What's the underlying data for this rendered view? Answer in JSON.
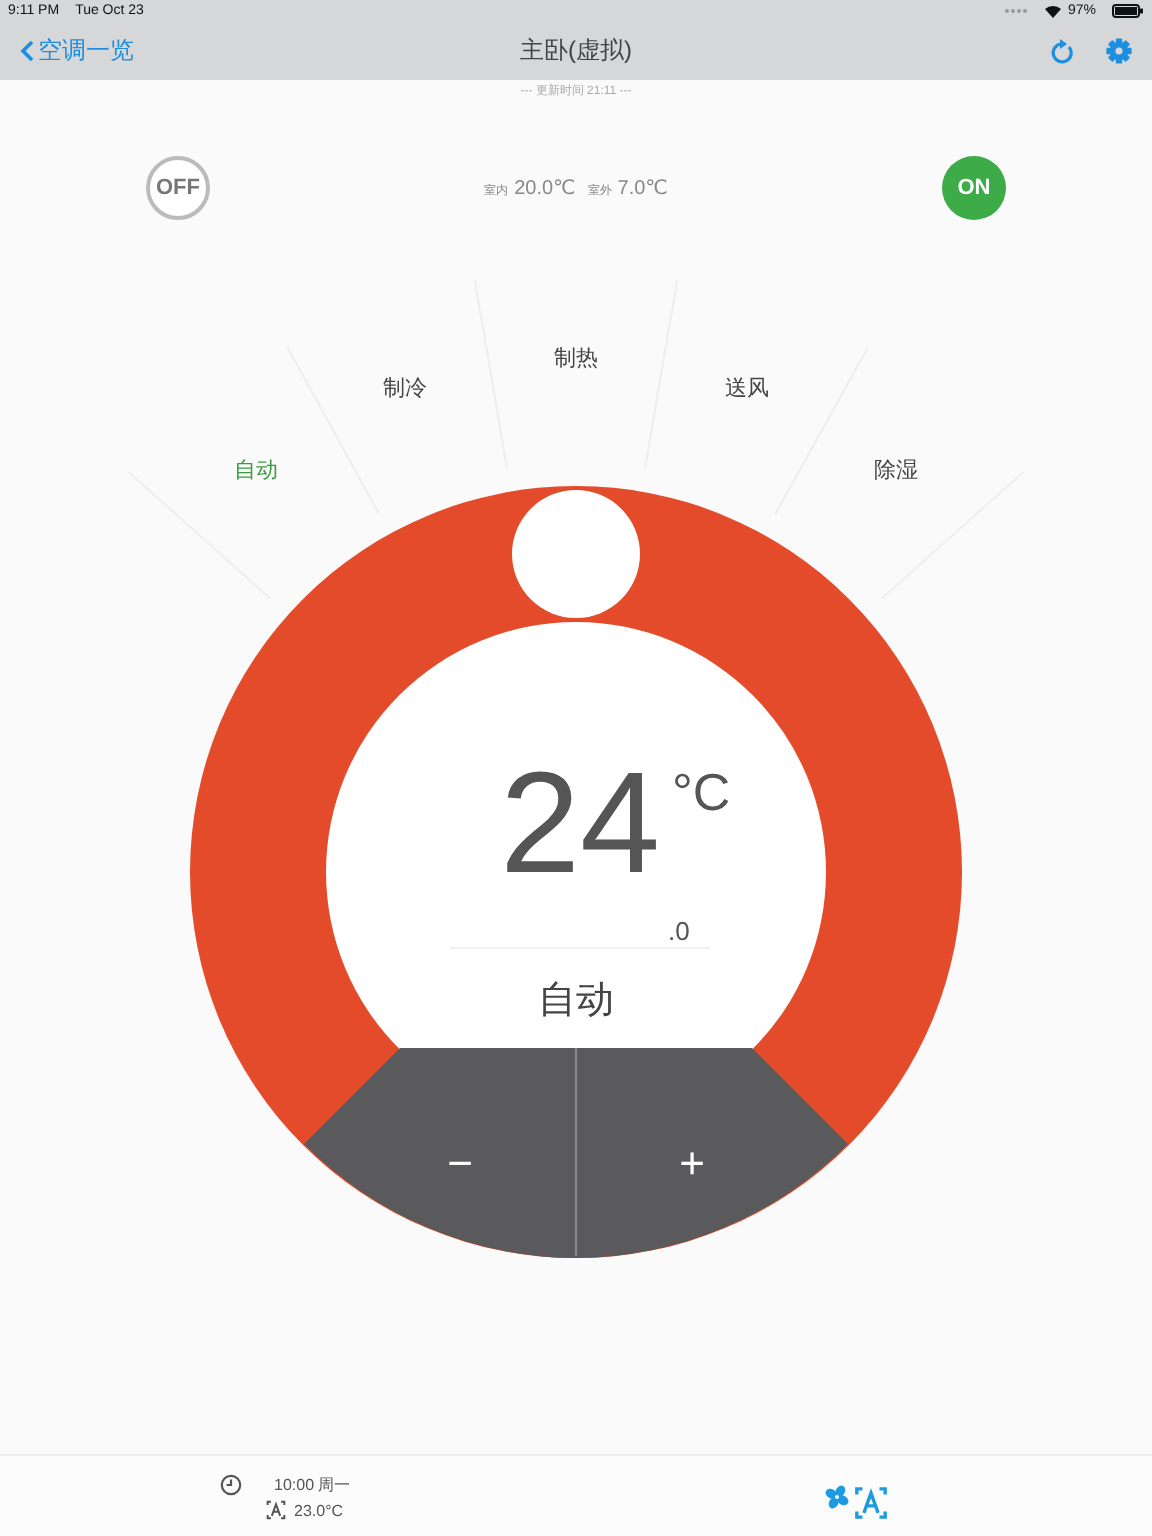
{
  "status_bar": {
    "time": "9:11 PM",
    "date": "Tue Oct 23",
    "battery": "97%"
  },
  "nav": {
    "back": "空调一览",
    "title": "主卧(虚拟)"
  },
  "updated": "--- 更新时间 21:11 ---",
  "power_buttons": [
    {
      "label": "OFF",
      "selected": false
    },
    {
      "label": "ON",
      "selected": true
    }
  ],
  "climate": {
    "indoor_label": "室内",
    "indoor": "20.0℃",
    "outdoor_label": "室外",
    "outdoor": "7.0℃"
  },
  "modes": [
    {
      "label": "自动",
      "selected": true
    },
    {
      "label": "制冷",
      "selected": false
    },
    {
      "label": "制热",
      "selected": false
    },
    {
      "label": "送风",
      "selected": false
    },
    {
      "label": "除湿",
      "selected": false
    }
  ],
  "setpoint": {
    "whole": "24",
    "unit": "°C",
    "decimal": ".0",
    "mode": "自动"
  },
  "controls": {
    "decrease": "−",
    "increase": "+"
  },
  "schedule": {
    "time": "10:00 周一",
    "temperature": "23.0°C"
  }
}
